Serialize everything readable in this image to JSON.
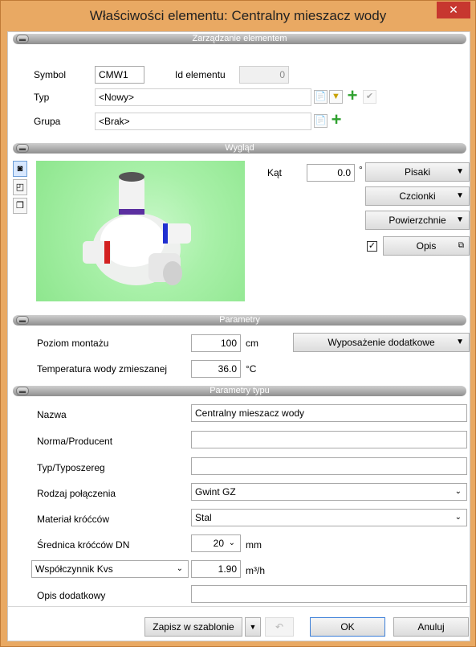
{
  "window": {
    "title": "Właściwości elementu: Centralny mieszacz wody",
    "close_glyph": "✕"
  },
  "management": {
    "header": "Zarządzanie elementem",
    "symbol_label": "Symbol",
    "symbol_value": "CMW1",
    "id_label": "Id elementu",
    "id_value": "0",
    "type_label": "Typ",
    "type_value": "<Nowy>",
    "group_label": "Grupa",
    "group_value": "<Brak>"
  },
  "appearance": {
    "header": "Wygląd",
    "angle_label": "Kąt",
    "angle_value": "0.0",
    "angle_unit": "°",
    "pens_label": "Pisaki",
    "fonts_label": "Czcionki",
    "surfaces_label": "Powierzchnie",
    "description_checked": true,
    "description_label": "Opis"
  },
  "parameters": {
    "header": "Parametry",
    "mount_level_label": "Poziom montażu",
    "mount_level_value": "100",
    "mount_level_unit": "cm",
    "accessories_label": "Wyposażenie dodatkowe",
    "mixed_temp_label": "Temperatura wody zmieszanej",
    "mixed_temp_value": "36.0",
    "mixed_temp_unit": "°C"
  },
  "type_parameters": {
    "header": "Parametry typu",
    "name_label": "Nazwa",
    "name_value": "Centralny mieszacz wody",
    "norm_label": "Norma/Producent",
    "norm_value": "",
    "type_series_label": "Typ/Typoszereg",
    "type_series_value": "",
    "connection_label": "Rodzaj połączenia",
    "connection_value": "Gwint GZ",
    "material_label": "Materiał króćców",
    "material_value": "Stal",
    "diameter_label": "Średnica króćców DN",
    "diameter_value": "20",
    "diameter_unit": "mm",
    "coef_select": "Współczynnik Kvs",
    "coef_value": "1.90",
    "coef_unit": "m³/h",
    "extra_desc_label": "Opis dodatkowy",
    "extra_desc_value": ""
  },
  "footer": {
    "save_template_label": "Zapisz w szablonie",
    "ok_label": "OK",
    "cancel_label": "Anuluj"
  },
  "colors": {
    "title_bar": "#e9a963",
    "close_button": "#c7372f",
    "preview_background": "#a8f0a8",
    "add_icon": "#2fa12f"
  }
}
